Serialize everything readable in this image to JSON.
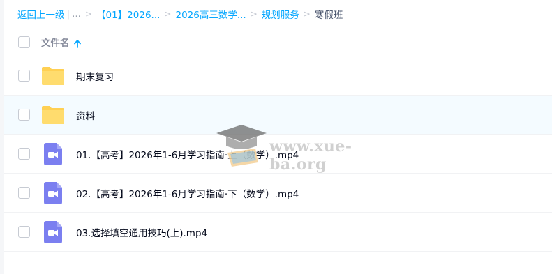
{
  "breadcrumb": {
    "back": "返回上一级",
    "pipe": "|",
    "ellipsis": "...",
    "sep": ">",
    "items": [
      "【01】2026...",
      "2026高三数学...",
      "规划服务"
    ],
    "current": "寒假班"
  },
  "header": {
    "column_label": "文件名",
    "sort_icon": "arrow-up-icon"
  },
  "files": [
    {
      "name": "期末复习",
      "type": "folder"
    },
    {
      "name": "资料",
      "type": "folder"
    },
    {
      "name": "01.【高考】2026年1-6月学习指南·上（数学）.mp4",
      "type": "video"
    },
    {
      "name": "02.【高考】2026年1-6月学习指南·下（数学）.mp4",
      "type": "video"
    },
    {
      "name": "03.选择填空通用技巧(上).mp4",
      "type": "video"
    }
  ],
  "watermark": {
    "text": "www.xue-ba.org"
  },
  "colors": {
    "link": "#06a7ff",
    "folder": "#ffd053",
    "video": "#7b7ff0",
    "hover_row": "#f4fbff"
  }
}
